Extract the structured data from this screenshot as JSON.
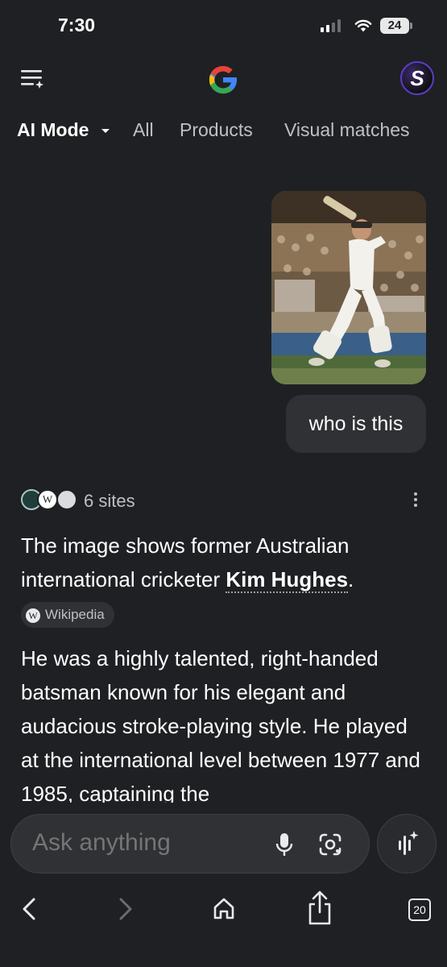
{
  "status_bar": {
    "time": "7:30",
    "battery": "24"
  },
  "header": {
    "menu_icon": "menu-sparkle-icon",
    "logo": "google-g-logo",
    "avatar_letter": "S"
  },
  "tabs": [
    {
      "label": "AI Mode",
      "active": true
    },
    {
      "label": "All",
      "active": false
    },
    {
      "label": "Products",
      "active": false
    },
    {
      "label": "Visual matches",
      "active": false
    }
  ],
  "query": {
    "image": "cricketer-batting-photo",
    "text": "who is this"
  },
  "sources": {
    "label": "6 sites"
  },
  "answer": {
    "p1_pre": "The image shows former Australian international cricketer ",
    "p1_name": "Kim Hughes",
    "p1_post": ".",
    "p1_chip": "Wikipedia",
    "p1_chip_icon": "W",
    "p2": "He was a highly talented, right-handed batsman known for his elegant and audacious stroke-playing style. He played at the international level between 1977 and 1985, captaining the"
  },
  "ask_bar": {
    "placeholder": "Ask anything"
  },
  "bottom_nav": {
    "tabs_count": "20"
  },
  "colors": {
    "background": "#1f2023",
    "surface": "#303134",
    "text": "#ffffff",
    "muted": "#bdc1c6"
  }
}
